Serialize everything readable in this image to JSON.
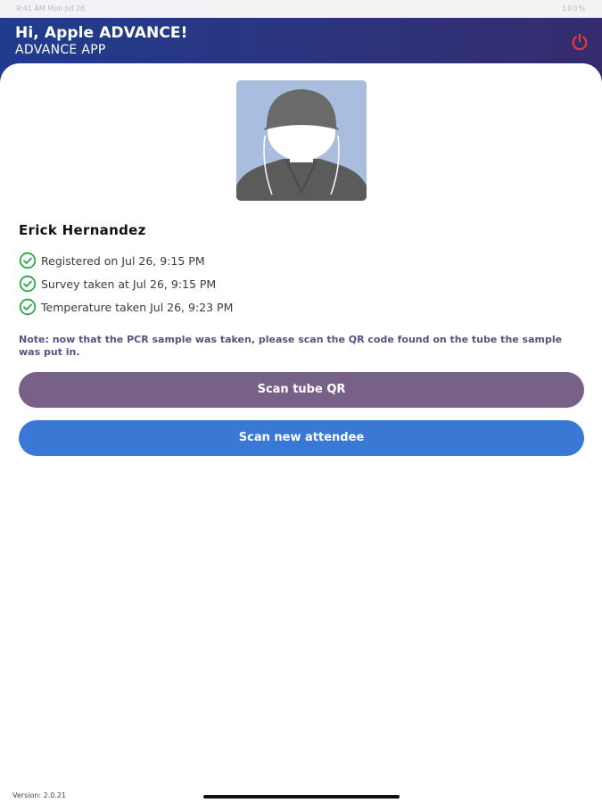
{
  "status_bar": {
    "left_text": "9:41 AM Mon Jul 26",
    "right_text": "100%"
  },
  "header": {
    "greeting": "Hi, Apple ADVANCE!",
    "app_name": "ADVANCE APP",
    "power_icon": "power-icon",
    "power_color": "#e23a3a",
    "gradient_start": "#1f3d8c",
    "gradient_end": "#342c6e"
  },
  "profile": {
    "name": "Erick Hernandez"
  },
  "status_items": [
    {
      "label": "Registered on Jul 26, 9:15 PM",
      "icon": "check-circle-icon"
    },
    {
      "label": "Survey taken at Jul 26, 9:15 PM",
      "icon": "check-circle-icon"
    },
    {
      "label": "Temperature taken Jul 26, 9:23 PM",
      "icon": "check-circle-icon"
    }
  ],
  "note": "Note: now that the PCR sample was taken, please scan the QR code found on the tube the sample was put in.",
  "buttons": {
    "scan_tube_qr": "Scan tube QR",
    "scan_new_attendee": "Scan new attendee"
  },
  "colors": {
    "check_green": "#2aa84a",
    "tube_button": "#776189",
    "new_button": "#3a78d6",
    "note_text": "#5e4f80"
  },
  "footer": {
    "version": "Version: 2.0.21"
  }
}
